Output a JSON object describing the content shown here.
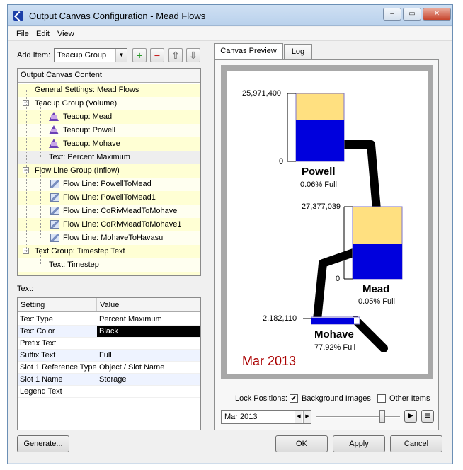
{
  "window": {
    "title": "Output Canvas Configuration - Mead Flows",
    "minimize_glyph": "–",
    "maximize_glyph": "▭",
    "close_glyph": "✕"
  },
  "menu": [
    "File",
    "Edit",
    "View"
  ],
  "toolbar": {
    "add_item_label": "Add Item:",
    "add_item_value": "Teacup Group",
    "add_glyph": "+",
    "remove_glyph": "−",
    "up_glyph": "⇧",
    "down_glyph": "⇩"
  },
  "tree": {
    "header": "Output Canvas Content",
    "items": [
      {
        "label": "General Settings: Mead Flows"
      },
      {
        "label": "Teacup Group (Volume)"
      },
      {
        "label": "Teacup: Mead"
      },
      {
        "label": "Teacup: Powell"
      },
      {
        "label": "Teacup: Mohave"
      },
      {
        "label": "Text: Percent Maximum"
      },
      {
        "label": "Flow Line Group (Inflow)"
      },
      {
        "label": "Flow Line: PowellToMead"
      },
      {
        "label": "Flow Line: PowellToMead1"
      },
      {
        "label": "Flow Line: CoRivMeadToMohave"
      },
      {
        "label": "Flow Line: CoRivMeadToMohave1"
      },
      {
        "label": "Flow Line: MohaveToHavasu"
      },
      {
        "label": "Text Group: Timestep Text"
      },
      {
        "label": "Text: Timestep"
      }
    ]
  },
  "properties": {
    "section_label": "Text:",
    "col_setting": "Setting",
    "col_value": "Value",
    "rows": [
      {
        "setting": "Text Type",
        "value": "Percent Maximum"
      },
      {
        "setting": "Text Color",
        "value": "Black"
      },
      {
        "setting": "Prefix Text",
        "value": ""
      },
      {
        "setting": "Suffix Text",
        "value": "Full"
      },
      {
        "setting": "Slot 1 Reference Type",
        "value": "Object / Slot Name"
      },
      {
        "setting": "Slot 1 Name",
        "value": "Storage"
      },
      {
        "setting": "Legend Text",
        "value": ""
      }
    ]
  },
  "tabs": {
    "preview": "Canvas Preview",
    "log": "Log"
  },
  "canvas": {
    "powell": {
      "name": "Powell",
      "max": "25,971,400",
      "min": "0",
      "pct": "0.06% Full",
      "fill": 0.6
    },
    "mead": {
      "name": "Mead",
      "max": "27,377,039",
      "min": "0",
      "pct": "0.05% Full",
      "fill": 0.48
    },
    "mohave": {
      "name": "Mohave",
      "max": "2,182,110",
      "pct": "77.92% Full",
      "fill": 0.9
    },
    "timestep": "Mar 2013",
    "colors": {
      "water": "#0000dd",
      "empty": "#ffe080",
      "flow": "#000000",
      "timestep": "#aa0000"
    }
  },
  "controls": {
    "lock_label": "Lock Positions:",
    "background_images": "Background Images",
    "background_checked": "✔",
    "other_items": "Other Items",
    "date_value": "Mar 2013",
    "play_glyph": "▶",
    "log_glyph": "≣"
  },
  "buttons": {
    "generate": "Generate...",
    "ok": "OK",
    "apply": "Apply",
    "cancel": "Cancel"
  }
}
